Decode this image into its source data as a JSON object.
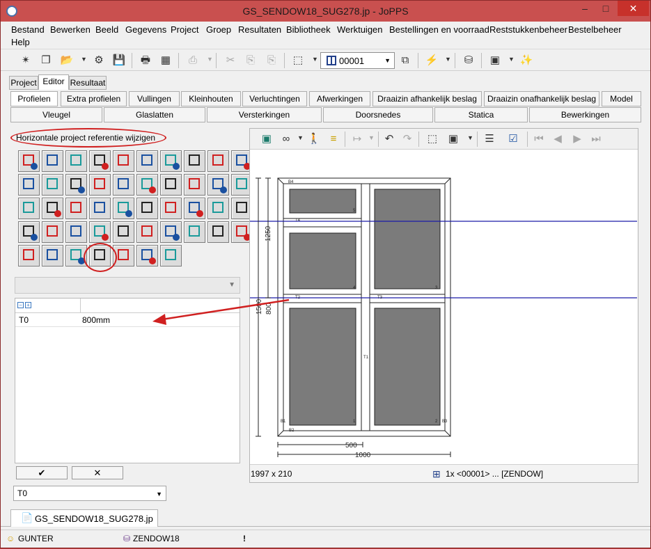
{
  "window": {
    "title": "GS_SENDOW18_SUG278.jp - JoPPS"
  },
  "menu": [
    "Bestand",
    "Bewerken",
    "Beeld",
    "Gegevens",
    "Project",
    "Groep",
    "Resultaten",
    "Bibliotheek",
    "Werktuigen",
    "Bestellingen en voorraad",
    "Reststukkenbeheer",
    "Bestelbeheer",
    "Help"
  ],
  "toolbar": {
    "combo_value": "00001"
  },
  "tabs": [
    "Project",
    "Editor",
    "Resultaat"
  ],
  "subtabs": [
    "Profielen",
    "Extra profielen",
    "Vullingen",
    "Kleinhouten",
    "Verluchtingen",
    "Afwerkingen",
    "Draaizin afhankelijk beslag",
    "Draaizin onafhankelijk beslag",
    "Model"
  ],
  "subtabs2": [
    "Vleugel",
    "Glaslatten",
    "Versterkingen",
    "Doorsnedes",
    "Statica",
    "Bewerkingen"
  ],
  "hint": "Horizontale project referentie wijzigen",
  "properties": {
    "rows": [
      {
        "key": "T0",
        "value": "800mm"
      }
    ]
  },
  "bottom_combo": "T0",
  "drawing": {
    "labels": {
      "b4": "B4",
      "t4": "T4",
      "t2": "T2",
      "t3": "T3",
      "t1": "T1",
      "b1": "B1",
      "b2": "B2",
      "b3": "B3",
      "n1": "1",
      "n2": "2",
      "n3": "3",
      "n4": "4",
      "n5": "5"
    },
    "dims": {
      "d1250": "1250",
      "d1500": "1500",
      "d800": "800",
      "d500": "500",
      "d1000": "1000"
    },
    "status_left": "1997 x 210",
    "status_right": "1x <00001> ... [ZENDOW]"
  },
  "doc_tab": "GS_SENDOW18_SUG278.jp",
  "statusbar": {
    "user": "GUNTER",
    "db": "ZENDOW18",
    "alert": "!"
  },
  "colors": {
    "title_bar": "#c9504f",
    "accent_red": "#d02020",
    "ref_line": "#1a1aa8"
  }
}
